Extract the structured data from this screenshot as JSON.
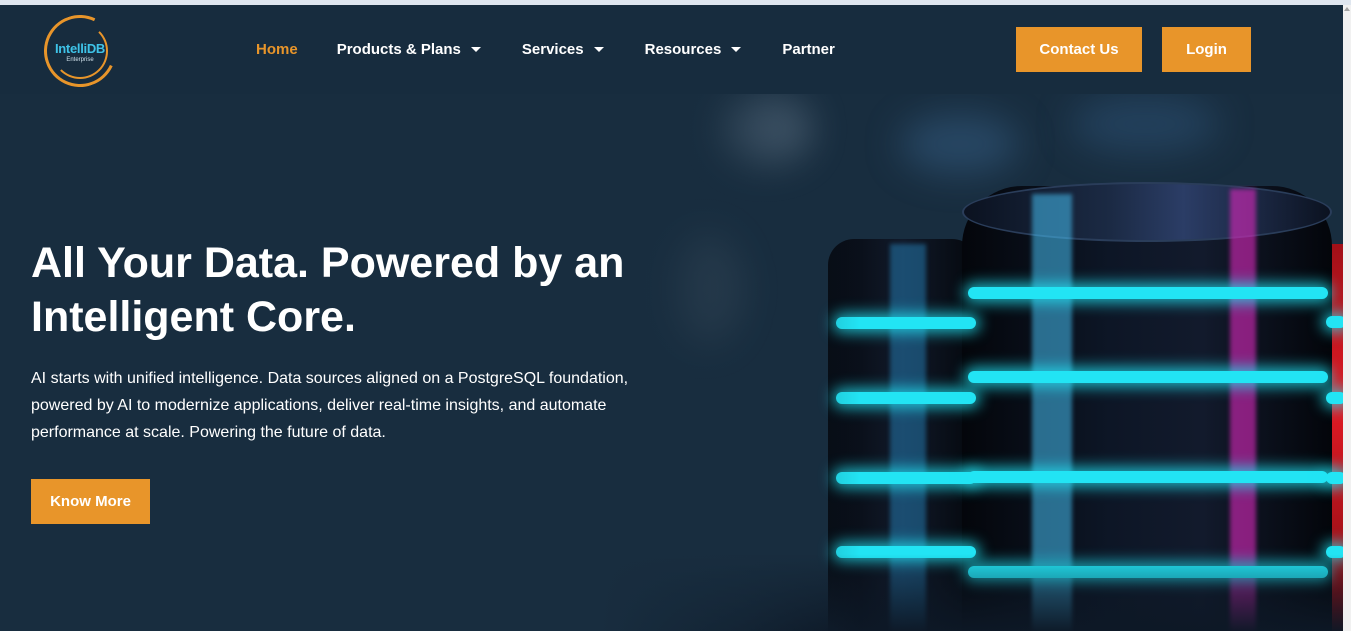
{
  "brand": {
    "logo_text": "IntelliDB",
    "logo_subtext": "Enterprise",
    "accent_color": "#e8952a",
    "background_color": "#182d3f"
  },
  "nav": {
    "items": [
      {
        "label": "Home",
        "active": true,
        "has_dropdown": false
      },
      {
        "label": "Products & Plans",
        "active": false,
        "has_dropdown": true
      },
      {
        "label": "Services",
        "active": false,
        "has_dropdown": true
      },
      {
        "label": "Resources",
        "active": false,
        "has_dropdown": true
      },
      {
        "label": "Partner",
        "active": false,
        "has_dropdown": false
      }
    ]
  },
  "header_buttons": {
    "contact": "Contact Us",
    "login": "Login"
  },
  "hero": {
    "title": "All Your Data. Powered by an Intelligent Core.",
    "description": "AI starts with unified intelligence. Data sources aligned on a PostgreSQL foundation, powered by AI to modernize applications, deliver real-time insights, and automate performance at scale. Powering the future of data.",
    "cta": "Know More"
  }
}
